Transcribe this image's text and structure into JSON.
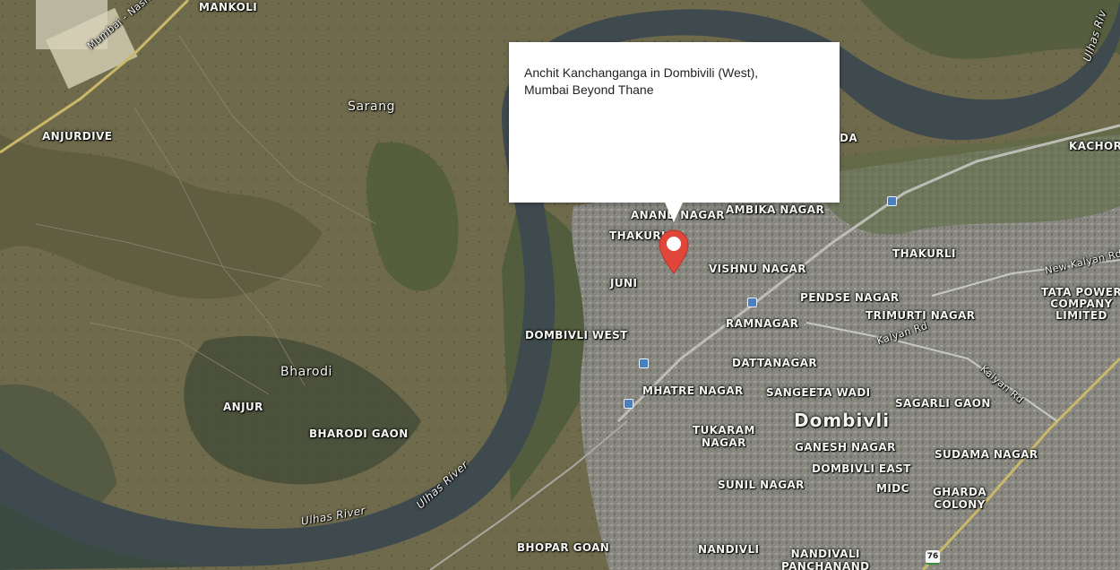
{
  "map": {
    "type": "satellite",
    "place_labels": {
      "mankoli": "MANKOLI",
      "sarang": "Sarang",
      "anjurdive": "ANJURDIVE",
      "bharodi": "Bharodi",
      "anjur": "ANJUR",
      "bharodi_gaon": "BHARODI GAON",
      "anand_nagar": "ANAND NAGAR",
      "ambika_nagar": "AMBIKA NAGAR",
      "thakurli_w": "THAKURLI",
      "vishnu_nagar": "VISHNU NAGAR",
      "juni": "JUNI",
      "dombivli_west": "DOMBIVLI WEST",
      "pendse_nagar": "PENDSE NAGAR",
      "trimurti_nagar": "TRIMURTI NAGAR",
      "ramnagar": "RAMNAGAR",
      "thakurli": "THAKURLI",
      "tata_power": "TATA POWER\nCOMPANY\nLIMITED",
      "dattanagar": "DATTANAGAR",
      "mhatre_nagar": "MHATRE NAGAR",
      "sangeeta_wadi": "SANGEETA WADI",
      "sagarli_gaon": "SAGARLI GAON",
      "dombivli": "Dombivli",
      "tukaram_nagar": "TUKARAM\nNAGAR",
      "ganesh_nagar": "GANESH NAGAR",
      "dombivli_east": "DOMBIVLI EAST",
      "sudama_nagar": "SUDAMA NAGAR",
      "sunil_nagar": "SUNIL NAGAR",
      "midc": "MIDC",
      "gharda_colony": "GHARDA\nCOLONY",
      "bhopar_goan": "BHOPAR GOAN",
      "nandivli": "NANDIVLI",
      "nandivali_panchanand": "NANDIVALI\nPANCHANAND",
      "kachore": "KACHOR",
      "da_fragment": "DA"
    },
    "road_labels": {
      "mumbai_nashik": "Mumbai - Nashik Expy",
      "new_kalyan": "New Kalyan Rd",
      "kalyan_rd_1": "Kalyan Rd",
      "kalyan_rd_2": "Kalyan Rd"
    },
    "river_labels": {
      "ulhas_1": "Ulhas River",
      "ulhas_2": "Ulhas River",
      "ulhas_3": "Ulhas Riv"
    },
    "highway_shield": "76"
  },
  "infowindow": {
    "title_line1": "Anchit Kanchanganga in Dombivili (West),",
    "title_line2": "Mumbai Beyond Thane"
  },
  "marker": {
    "color": "#e0463a",
    "icon": "map-pin-icon"
  }
}
